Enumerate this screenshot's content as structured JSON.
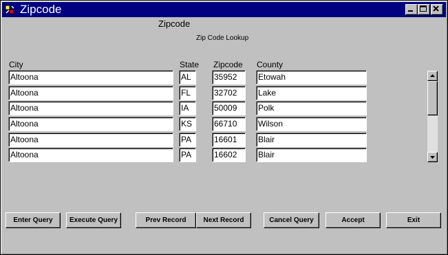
{
  "window": {
    "title": "Zipcode"
  },
  "form": {
    "title": "Zipcode",
    "subtitle": "Zip Code Lookup"
  },
  "columns": {
    "city": "City",
    "state": "State",
    "zipcode": "Zipcode",
    "county": "County"
  },
  "rows": [
    {
      "city": "Altoona",
      "state": "AL",
      "zipcode": "35952",
      "county": "Etowah"
    },
    {
      "city": "Altoona",
      "state": "FL",
      "zipcode": "32702",
      "county": "Lake"
    },
    {
      "city": "Altoona",
      "state": "IA",
      "zipcode": "50009",
      "county": "Polk"
    },
    {
      "city": "Altoona",
      "state": "KS",
      "zipcode": "66710",
      "county": "Wilson"
    },
    {
      "city": "Altoona",
      "state": "PA",
      "zipcode": "16601",
      "county": "Blair"
    },
    {
      "city": "Altoona",
      "state": "PA",
      "zipcode": "16602",
      "county": "Blair"
    }
  ],
  "buttons": {
    "enter_query": "Enter Query",
    "execute_query": "Execute Query",
    "prev_record": "Prev Record",
    "next_record": "Next Record",
    "cancel_query": "Cancel Query",
    "accept": "Accept",
    "exit": "Exit"
  },
  "icons": {
    "app": "oracle-forms-app-icon",
    "minimize": "minimize-icon",
    "maximize": "maximize-icon",
    "close": "close-icon",
    "scroll_up": "arrow-up-icon",
    "scroll_down": "arrow-down-icon"
  },
  "colors": {
    "titlebar": "#000080",
    "face": "#c0c0c0",
    "field_bg": "#ffffff"
  }
}
